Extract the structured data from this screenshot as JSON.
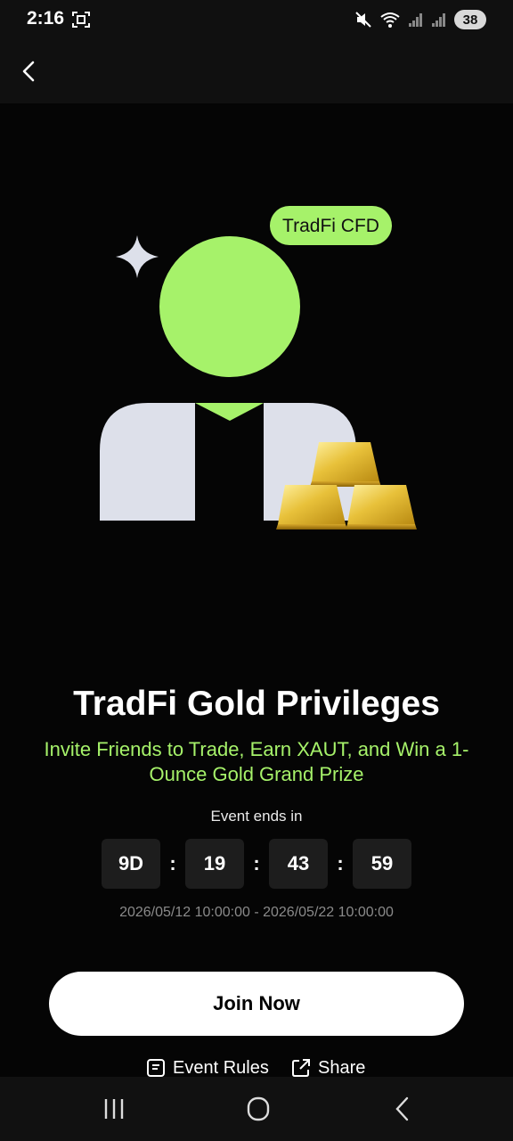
{
  "status_bar": {
    "time": "2:16",
    "battery": "38"
  },
  "hero": {
    "badge": "TradFi CFD"
  },
  "event": {
    "title": "TradFi Gold Privileges",
    "subtitle": "Invite Friends to Trade, Earn XAUT, and Win a 1-Ounce Gold Grand Prize",
    "ends_label": "Event ends in",
    "countdown": {
      "days": "9D",
      "hours": "19",
      "minutes": "43",
      "seconds": "59",
      "separator": ":"
    },
    "date_range": "2026/05/12 10:00:00 - 2026/05/22 10:00:00"
  },
  "actions": {
    "join_label": "Join Now",
    "rules_label": "Event Rules",
    "share_label": "Share"
  },
  "icons": {
    "back": "chevron-left-icon",
    "rules": "document-icon",
    "share": "share-icon",
    "nav_recents": "recents-icon",
    "nav_home": "home-icon",
    "nav_back": "back-icon"
  },
  "colors": {
    "accent_green": "#a6f26a",
    "background": "#050505",
    "button_bg": "#ffffff"
  }
}
